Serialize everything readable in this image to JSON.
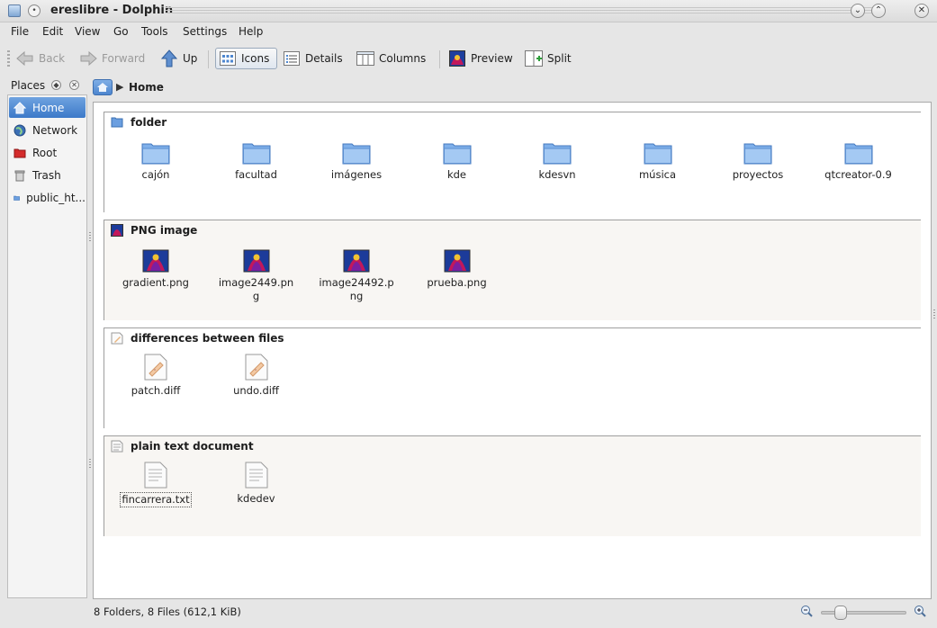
{
  "window": {
    "title": "ereslibre - Dolphin",
    "menu_glyph": "•",
    "min_glyph": "⌄",
    "max_glyph": "⌃",
    "close_glyph": "✕"
  },
  "menubar": {
    "items": [
      "File",
      "Edit",
      "View",
      "Go",
      "Tools",
      "Settings",
      "Help"
    ]
  },
  "toolbar": {
    "back": "Back",
    "forward": "Forward",
    "up": "Up",
    "icons": "Icons",
    "details": "Details",
    "columns": "Columns",
    "preview": "Preview",
    "split": "Split"
  },
  "places": {
    "header": "Places",
    "items": [
      {
        "label": "Home",
        "icon": "home-icon",
        "color": "#4d86cf"
      },
      {
        "label": "Network",
        "icon": "network-globe-icon",
        "color": "#3b6fb5"
      },
      {
        "label": "Root",
        "icon": "root-folder-icon",
        "color": "#d42b2b"
      },
      {
        "label": "Trash",
        "icon": "trash-icon",
        "color": "#8a8a8a"
      },
      {
        "label": "public_ht...",
        "icon": "folder-icon",
        "color": "#6b9fe0"
      }
    ],
    "selected": "Home"
  },
  "breadcrumb": {
    "crumbs": [
      "Home"
    ]
  },
  "groups": [
    {
      "title": "folder",
      "type": "folder",
      "items": [
        "cajón",
        "facultad",
        "imágenes",
        "kde",
        "kdesvn",
        "música",
        "proyectos",
        "qtcreator-0.9"
      ]
    },
    {
      "title": "PNG image",
      "type": "png",
      "items": [
        "gradient.png",
        "image2449.png",
        "image24492.png",
        "prueba.png"
      ]
    },
    {
      "title": "differences between files",
      "type": "diff",
      "items": [
        "patch.diff",
        "undo.diff"
      ]
    },
    {
      "title": "plain text document",
      "type": "text",
      "items": [
        "fincarrera.txt",
        "kdedev"
      ]
    }
  ],
  "status": {
    "text": "8 Folders, 8 Files (612,1 KiB)",
    "zoom_level": 0.17
  },
  "colors": {
    "folder": "#7fb0ea",
    "selection": "#3c79c9"
  }
}
